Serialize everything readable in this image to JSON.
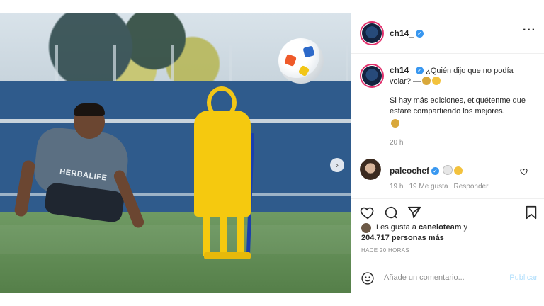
{
  "post": {
    "username": "ch14_",
    "more_label": "···",
    "caption_line1": "¿Quién dijo que no podía volar?",
    "caption_line2": "Si hay más ediciones, etiquétenme que estaré compartiendo los mejores.",
    "caption_time": "20 h",
    "jersey_sponsor": "HERBALIFE"
  },
  "comment": {
    "username": "paleochef",
    "time": "19 h",
    "likes": "19 Me gusta",
    "reply": "Responder"
  },
  "likes": {
    "prefix": "Les gusta a ",
    "user": "caneloteam",
    "suffix": " y",
    "count": "204.717 personas más"
  },
  "ago": "HACE 20 HORAS",
  "add_comment": {
    "placeholder": "Añade un comentario...",
    "publish": "Publicar"
  },
  "icons": [
    "more-icon",
    "verified-icon",
    "heart-icon",
    "comment-icon",
    "share-icon",
    "bookmark-icon",
    "smile-icon",
    "next-icon"
  ],
  "colors": {
    "verified": "#3897f0",
    "publish_disabled": "#b2dffc",
    "story_ring": "#e1306c"
  }
}
